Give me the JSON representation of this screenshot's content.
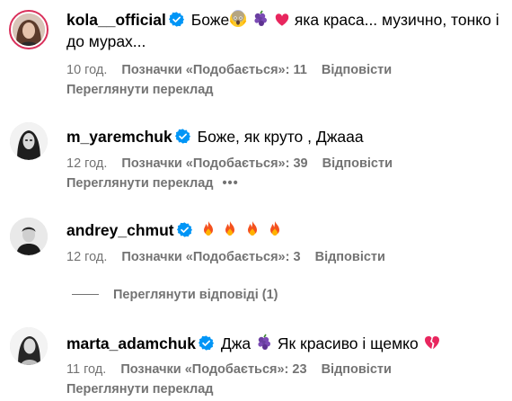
{
  "comments": [
    {
      "username": "kola__official",
      "text_line1_a": "Боже",
      "text_line1_b": "яка краса... музично, тонко і",
      "text_line2": "до мурах...",
      "time": "10 год.",
      "likes": "Позначки «Подобається»: 11",
      "reply": "Відповісти",
      "translate": "Переглянути переклад"
    },
    {
      "username": "m_yaremchuk",
      "text": "Боже, як круто , Джааа",
      "time": "12 год.",
      "likes": "Позначки «Подобається»: 39",
      "reply": "Відповісти",
      "translate": "Переглянути переклад",
      "more": "•••"
    },
    {
      "username": "andrey_chmut",
      "time": "12 год.",
      "likes": "Позначки «Подобається»: 3",
      "reply": "Відповісти"
    },
    {
      "username": "marta_adamchuk",
      "text_a": "Джа",
      "text_b": "Як красиво і щемко",
      "time": "11 год.",
      "likes": "Позначки «Подобається»: 23",
      "reply": "Відповісти",
      "translate": "Переглянути переклад"
    }
  ],
  "view_replies": "Переглянути відповіді (1)",
  "icons": {
    "verified": "verified-badge-icon",
    "fire": "fire-emoji",
    "grapes": "grapes-emoji",
    "heart": "red-heart-emoji",
    "broken_heart": "broken-heart-emoji",
    "shocked": "screaming-face-emoji"
  },
  "colors": {
    "verified_blue": "#0095f6",
    "meta_gray": "#737373",
    "story_ring": "#d9305b"
  }
}
